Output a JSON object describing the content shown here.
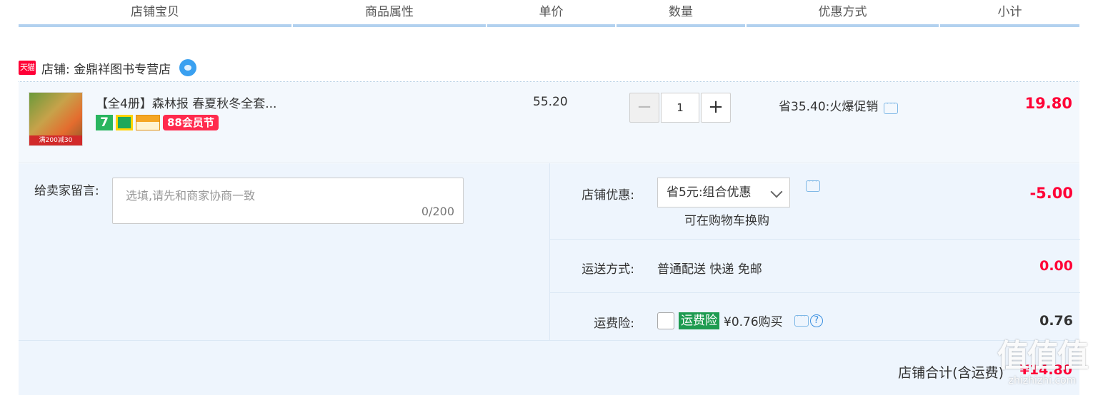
{
  "header": {
    "columns": [
      "店铺宝贝",
      "商品属性",
      "单价",
      "数量",
      "优惠方式",
      "小计"
    ]
  },
  "shop": {
    "badge": "天猫",
    "label": "店铺: 金鼎祥图书专营店",
    "chat_icon": "wangwang-icon"
  },
  "item": {
    "thumb_caption": "满200减30",
    "title": "【全4册】森林报 春夏秋冬全套...",
    "badges": {
      "seven": "7",
      "gift": "gift-icon",
      "card": "card-icon",
      "member": "88会员节"
    },
    "unit_price": "55.20",
    "quantity": "1",
    "minus": "−",
    "plus": "+",
    "promo": "省35.40:火爆促销",
    "subtotal": "19.80"
  },
  "message": {
    "label": "给卖家留言:",
    "placeholder": "选填,请先和商家协商一致",
    "counter": "0/200"
  },
  "shop_discount": {
    "label": "店铺优惠:",
    "selected": "省5元:组合优惠",
    "hint": "可在购物车换购",
    "value": "-5.00"
  },
  "shipping": {
    "label": "运送方式:",
    "method": "普通配送 快递 免邮",
    "value": "0.00"
  },
  "insurance": {
    "label": "运费险:",
    "tag": "运费险",
    "price": "¥0.76购买",
    "help": "?",
    "value": "0.76",
    "checked": false
  },
  "total": {
    "label": "店铺合计(含运费)",
    "value": "¥14.80"
  },
  "watermark": {
    "big": "值值值",
    "small": "zhizhizhi.com"
  },
  "colors": {
    "accent_red": "#ff0036",
    "header_line": "#b2d1ef",
    "panel_bg": "#eef5fd"
  }
}
